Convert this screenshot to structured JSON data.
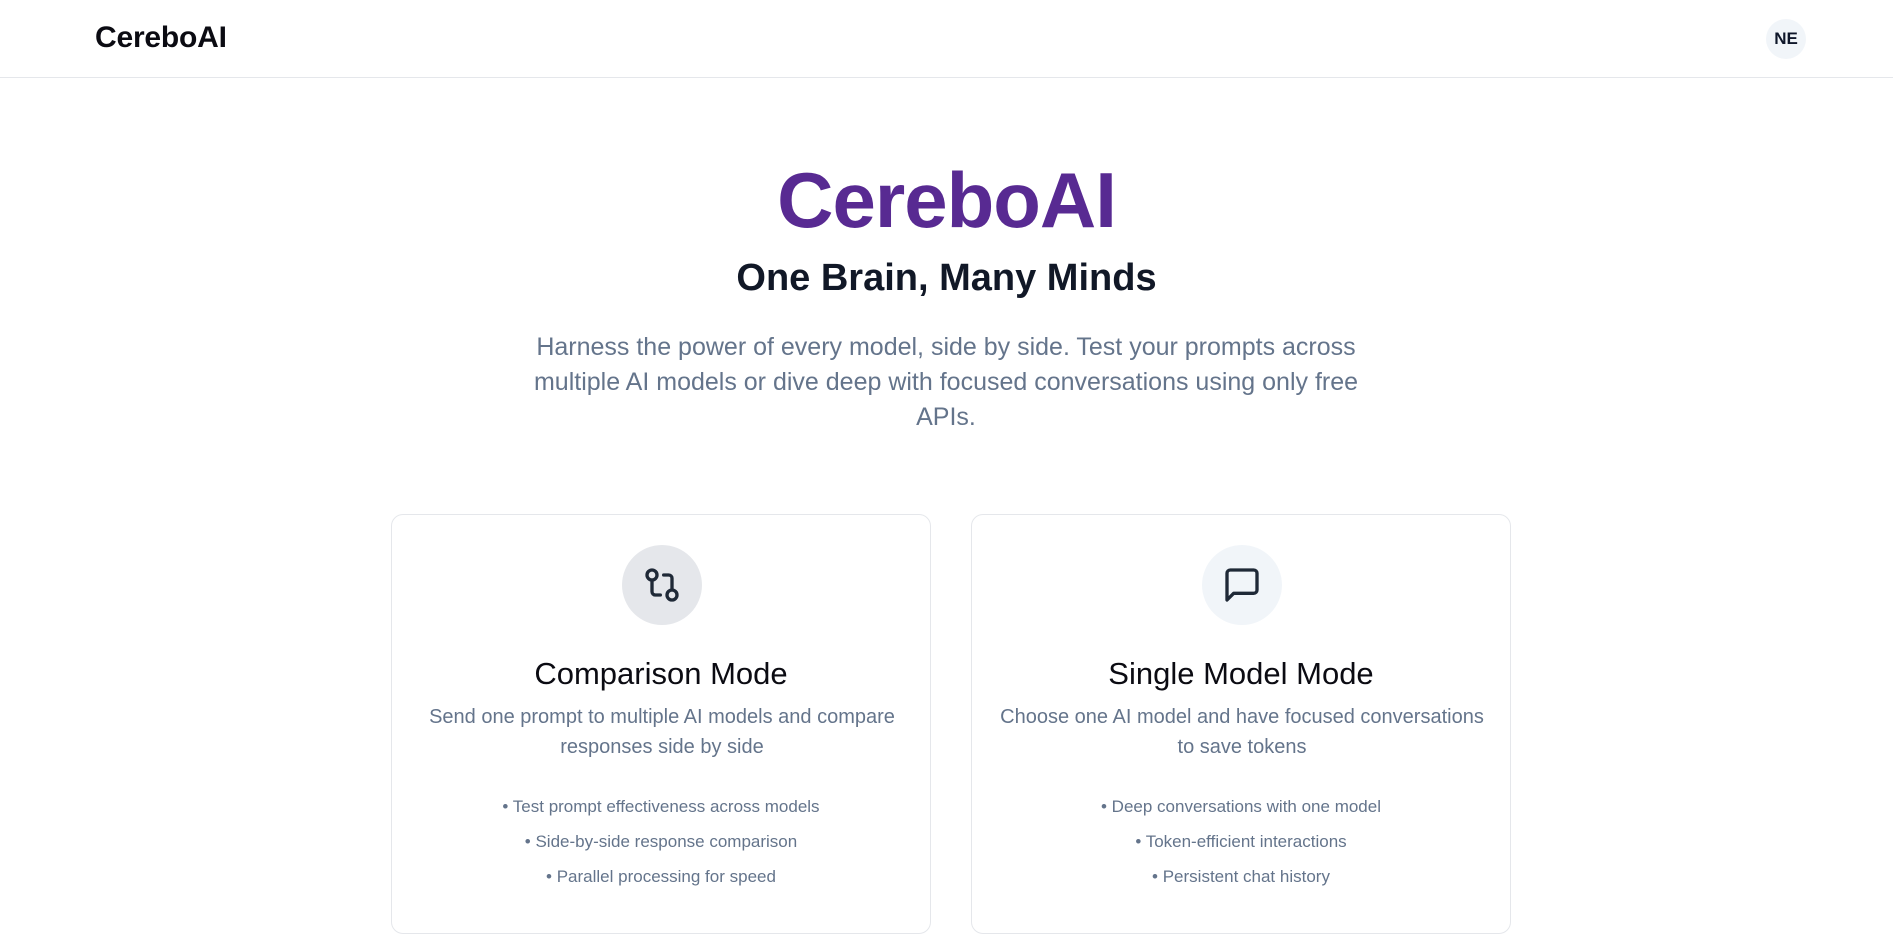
{
  "header": {
    "brand": "CereboAI",
    "avatar_initials": "NE"
  },
  "hero": {
    "title": "CereboAI",
    "tagline": "One Brain, Many Minds",
    "description": "Harness the power of every model, side by side. Test your prompts across multiple AI models or dive deep with focused conversations using only free APIs.",
    "title_color": "#582a92"
  },
  "modes": [
    {
      "icon": "git-compare-icon",
      "title": "Comparison Mode",
      "description": "Send one prompt to multiple AI models and compare responses side by side",
      "features": [
        "• Test prompt effectiveness across models",
        "• Side-by-side response comparison",
        "• Parallel processing for speed"
      ]
    },
    {
      "icon": "message-square-icon",
      "title": "Single Model Mode",
      "description": "Choose one AI model and have focused conversations to save tokens",
      "features": [
        "• Deep conversations with one model",
        "• Token-efficient interactions",
        "• Persistent chat history"
      ]
    }
  ]
}
